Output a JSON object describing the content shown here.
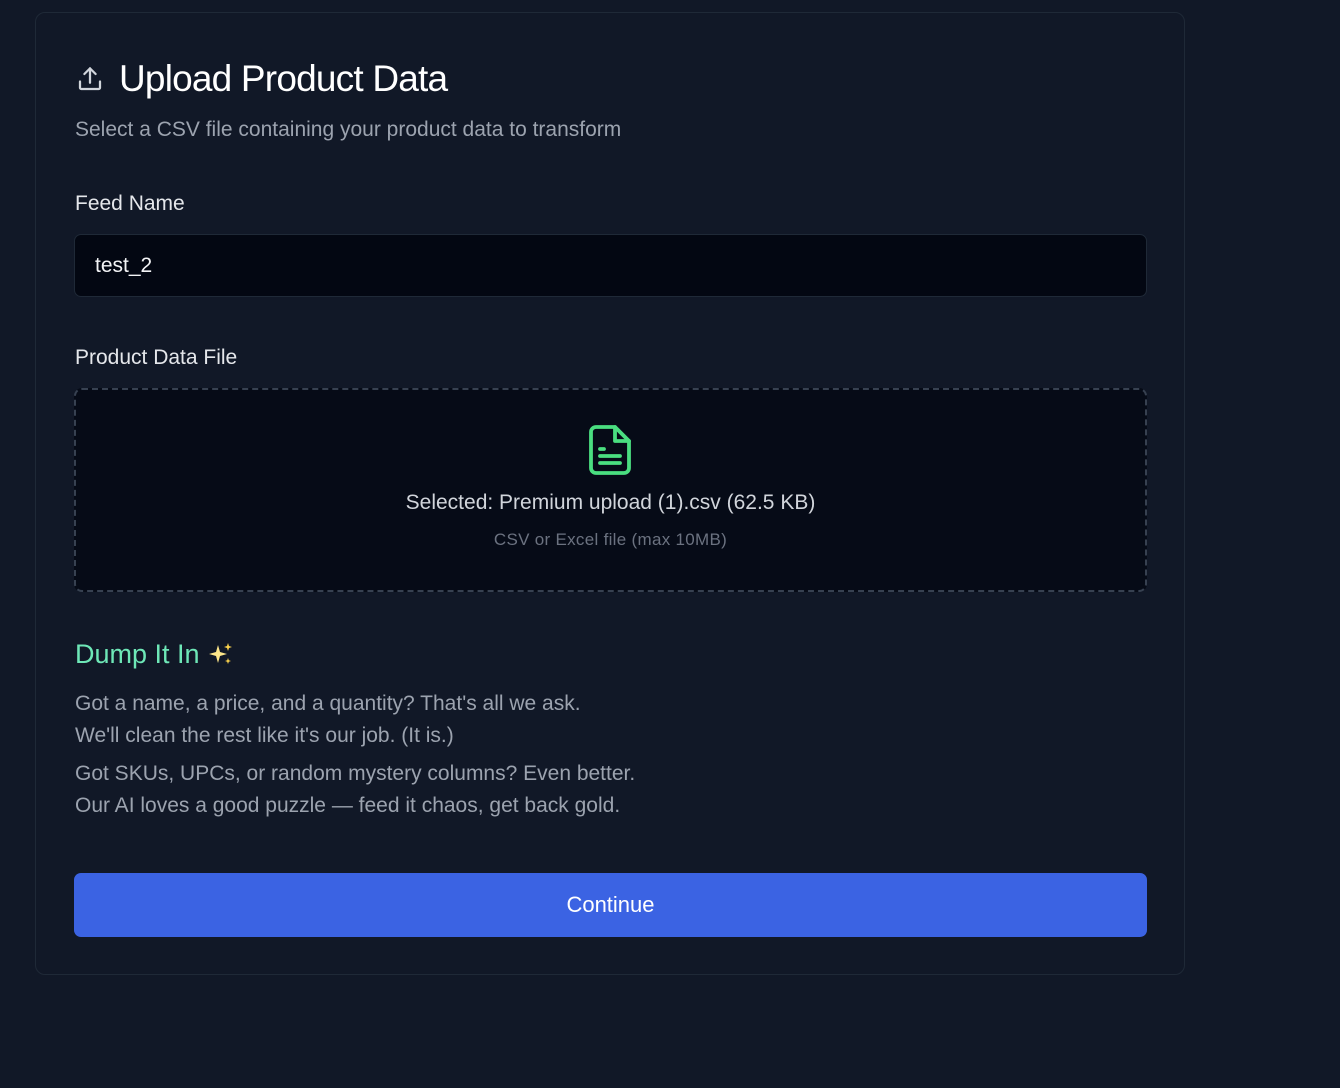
{
  "header": {
    "icon": "upload-icon",
    "title": "Upload Product Data",
    "subtitle": "Select a CSV file containing your product data to transform"
  },
  "form": {
    "feed_name_label": "Feed Name",
    "feed_name_value": "test_2",
    "file_label": "Product Data File"
  },
  "dropzone": {
    "icon": "file-text-icon",
    "icon_color": "#4ade80",
    "selected_text": "Selected: Premium upload (1).csv (62.5 KB)",
    "hint_text": "CSV or Excel file (max 10MB)"
  },
  "promo": {
    "title": "Dump It In",
    "title_icon": "sparkles-icon",
    "title_color": "#6ee7b7",
    "lines_1": [
      "Got a name, a price, and a quantity? That's all we ask.",
      "We'll clean the rest like it's our job. (It is.)"
    ],
    "lines_2": [
      "Got SKUs, UPCs, or random mystery columns? Even better.",
      "Our AI loves a good puzzle — feed it chaos, get back gold."
    ]
  },
  "actions": {
    "continue_label": "Continue",
    "accent_color": "#3b63e3"
  }
}
